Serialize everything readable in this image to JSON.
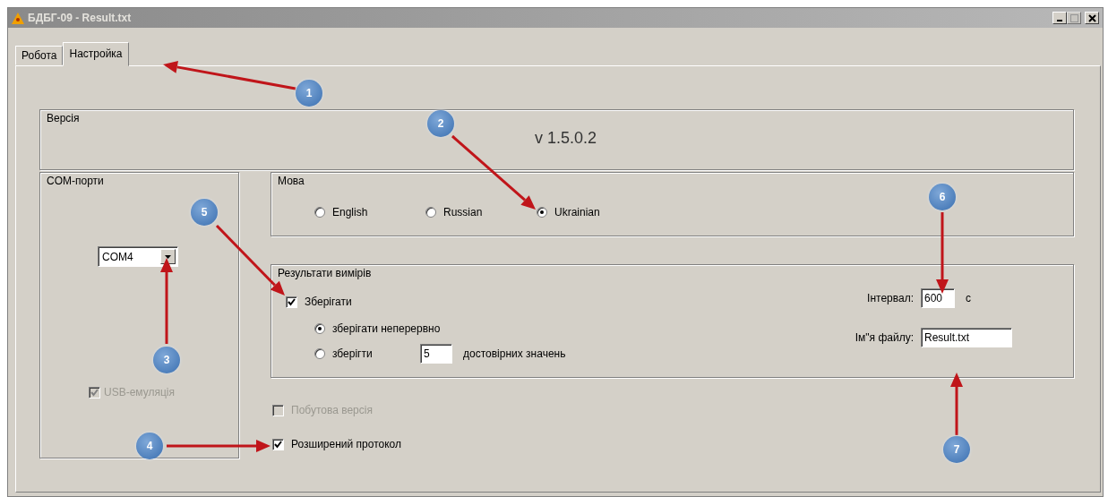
{
  "window": {
    "title": "БДБГ-09 - Result.txt"
  },
  "tabs": [
    {
      "label": "Робота",
      "selected": false
    },
    {
      "label": "Настройка",
      "selected": true
    }
  ],
  "version_group": {
    "title": "Версія",
    "version": "v 1.5.0.2"
  },
  "com_group": {
    "title": "COM-порти",
    "port": "COM4",
    "usb_emulation": {
      "label": "USB-емуляція",
      "checked": true,
      "disabled": true
    }
  },
  "language_group": {
    "title": "Мова",
    "options": [
      {
        "label": "English",
        "selected": false
      },
      {
        "label": "Russian",
        "selected": false
      },
      {
        "label": "Ukrainian",
        "selected": true
      }
    ]
  },
  "results_group": {
    "title": "Результати вимірів",
    "save": {
      "label": "Зберігати",
      "checked": true
    },
    "modes": [
      {
        "label": "зберігати неперервно",
        "selected": true
      },
      {
        "label": "зберігти",
        "selected": false,
        "count": "5",
        "suffix": "достовірних значень"
      }
    ],
    "interval": {
      "label": "Інтервал:",
      "value": "600",
      "unit": "с"
    },
    "filename": {
      "label": "Ім\"я файлу:",
      "value": "Result.txt"
    }
  },
  "options": [
    {
      "label": "Побутова версія",
      "checked": false,
      "disabled": true
    },
    {
      "label": "Розширений протокол",
      "checked": true,
      "disabled": false
    }
  ],
  "annotations": [
    {
      "number": "1"
    },
    {
      "number": "2"
    },
    {
      "number": "3"
    },
    {
      "number": "4"
    },
    {
      "number": "5"
    },
    {
      "number": "6"
    },
    {
      "number": "7"
    }
  ]
}
